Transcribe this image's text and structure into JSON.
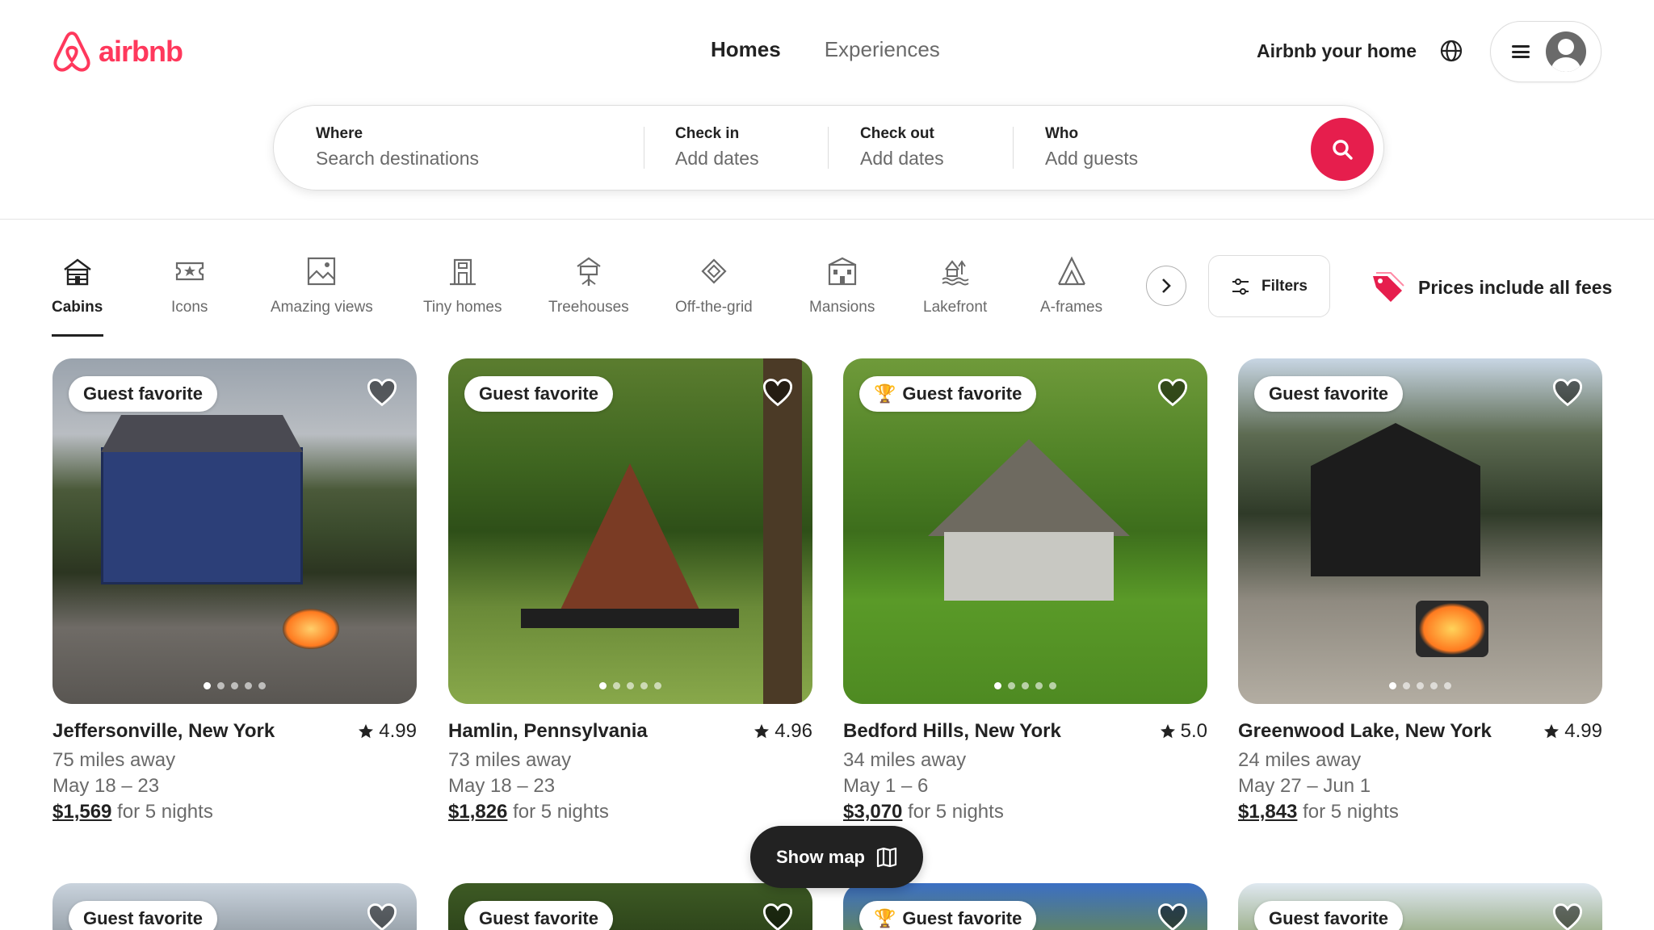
{
  "brand": {
    "name": "airbnb",
    "color": "#ff385c"
  },
  "nav": {
    "tabs": [
      "Homes",
      "Experiences"
    ],
    "active": "Homes"
  },
  "header": {
    "host_link": "Airbnb your home",
    "globe_icon": "globe-icon",
    "menu_icon": "menu-icon"
  },
  "search": {
    "where": {
      "label": "Where",
      "placeholder": "Search destinations"
    },
    "check_in": {
      "label": "Check in",
      "placeholder": "Add dates"
    },
    "check_out": {
      "label": "Check out",
      "placeholder": "Add dates"
    },
    "who": {
      "label": "Who",
      "placeholder": "Add guests"
    },
    "button_color": "#e61e4d"
  },
  "categories": [
    {
      "label": "Cabins",
      "icon": "cabin-icon",
      "active": true
    },
    {
      "label": "Icons",
      "icon": "ticket-icon"
    },
    {
      "label": "Amazing views",
      "icon": "view-icon"
    },
    {
      "label": "Tiny homes",
      "icon": "tiny-home-icon"
    },
    {
      "label": "Treehouses",
      "icon": "treehouse-icon"
    },
    {
      "label": "Off-the-grid",
      "icon": "off-grid-icon"
    },
    {
      "label": "Mansions",
      "icon": "mansion-icon"
    },
    {
      "label": "Lakefront",
      "icon": "lakefront-icon"
    },
    {
      "label": "A-frames",
      "icon": "a-frame-icon"
    }
  ],
  "filters": {
    "label": "Filters"
  },
  "fees_notice": {
    "label": "Prices include all fees"
  },
  "listings": [
    {
      "badge": "Guest favorite",
      "trophy": false,
      "city": "Jeffersonville, New York",
      "rating": "4.99",
      "distance": "75 miles away",
      "dates": "May 18 – 23",
      "price": "$1,569",
      "price_suffix": "for 5 nights"
    },
    {
      "badge": "Guest favorite",
      "trophy": false,
      "city": "Hamlin, Pennsylvania",
      "rating": "4.96",
      "distance": "73 miles away",
      "dates": "May 18 – 23",
      "price": "$1,826",
      "price_suffix": "for 5 nights"
    },
    {
      "badge": "Guest favorite",
      "trophy": true,
      "city": "Bedford Hills, New York",
      "rating": "5.0",
      "distance": "34 miles away",
      "dates": "May 1 – 6",
      "price": "$3,070",
      "price_suffix": "for 5 nights"
    },
    {
      "badge": "Guest favorite",
      "trophy": false,
      "city": "Greenwood Lake, New York",
      "rating": "4.99",
      "distance": "24 miles away",
      "dates": "May 27 – Jun 1",
      "price": "$1,843",
      "price_suffix": "for 5 nights"
    }
  ],
  "listings_row2": [
    {
      "badge": "Guest favorite",
      "trophy": false
    },
    {
      "badge": "Guest favorite",
      "trophy": false
    },
    {
      "badge": "Guest favorite",
      "trophy": true
    },
    {
      "badge": "Guest favorite",
      "trophy": false
    }
  ],
  "show_map": {
    "label": "Show map"
  }
}
